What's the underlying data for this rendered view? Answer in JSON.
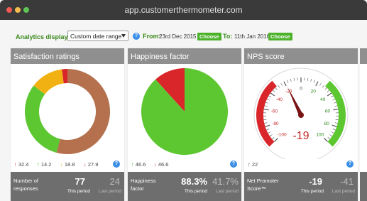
{
  "browser": {
    "url": "app.customerthermometer.com"
  },
  "toolbar": {
    "analytics_label": "Analytics display:",
    "range_select": "Custom date range",
    "from_label": "From:",
    "from_date": "23rd Dec 2015",
    "to_label": "To:",
    "to_date": "11th Jan 2016",
    "choose_label": "Choose",
    "help_glyph": "?"
  },
  "panels": {
    "satisfaction": {
      "title": "Satisfaction ratings",
      "stats": [
        "32.4",
        "14.2",
        "18.8",
        "27.9"
      ],
      "footer_label": "Number of responses",
      "this_value": "77",
      "last_value": "24",
      "this_label": "This period",
      "last_label": "Last period"
    },
    "happiness": {
      "title": "Happiness factor",
      "stats": [
        "46.6",
        "46.6"
      ],
      "footer_label": "Happiness factor",
      "this_value": "88.3%",
      "last_value": "41.7%",
      "this_label": "This period",
      "last_label": "Last period"
    },
    "nps": {
      "title": "NPS score",
      "stats": [
        "22"
      ],
      "gauge_labels": [
        "-100",
        "-80",
        "-60",
        "-40",
        "-20",
        "0",
        "20",
        "40",
        "60",
        "80",
        "100"
      ],
      "gauge_value": "-19",
      "footer_label": "Net Promoter Score™",
      "this_value": "-19",
      "last_value": "-41",
      "this_label": "This period",
      "last_label": "Last period"
    }
  },
  "colors": {
    "green": "#5dc732",
    "orange": "#f2b112",
    "brown": "#b5714d",
    "red": "#d8262b"
  },
  "chart_data": [
    {
      "type": "pie",
      "categories": [
        "brown",
        "green",
        "orange",
        "red"
      ],
      "values": [
        52,
        30,
        12,
        2
      ]
    },
    {
      "type": "pie",
      "categories": [
        "green",
        "red"
      ],
      "values": [
        88.3,
        11.7
      ]
    }
  ]
}
